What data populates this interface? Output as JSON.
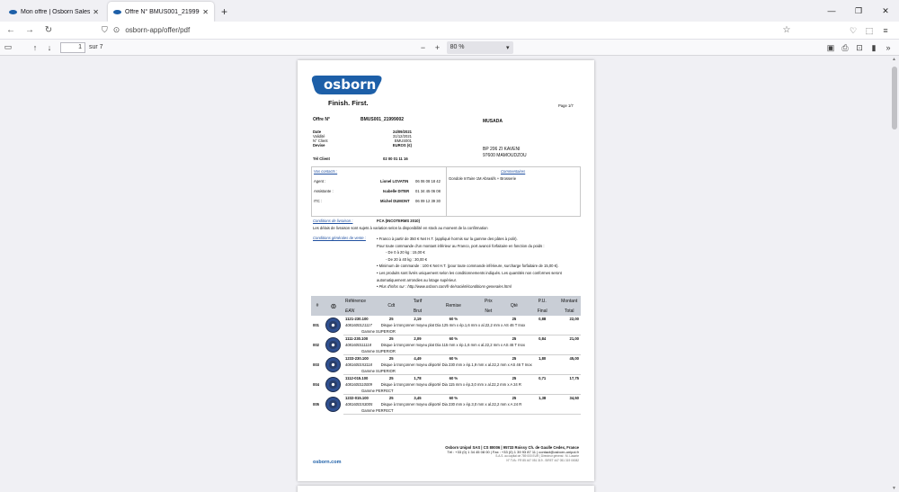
{
  "tabs": [
    {
      "title": "Mon offre | Osborn Sales Tool",
      "active": false
    },
    {
      "title": "Offre N° BMUS001_21999002 - Osborn...",
      "active": true
    }
  ],
  "nav": {
    "url": "osborn-app/offer/pdf"
  },
  "pdf_toolbar": {
    "page_current": "1",
    "page_total_label": "sur 7",
    "zoom": "80 %"
  },
  "doc": {
    "logo_text": "osborn",
    "tagline": "Finish. First.",
    "page_label": "Page 1/7",
    "offer_label": "Offre N°",
    "offer_number": "BMUS001_21999002",
    "customer_name": "MUSADA",
    "info_rows": [
      {
        "label": "Date",
        "value": "24/09/2021"
      },
      {
        "label": "Validité",
        "value": "31/12/2021"
      },
      {
        "label": "N° Client",
        "value": "BMUS001"
      },
      {
        "label": "Devise",
        "value": "EUROS (€)"
      }
    ],
    "tel_label": "Tél Client",
    "tel_value": "02 00 01 11 16",
    "address_line1": "BP 206 ZI KAVENI",
    "address_line2": "97600 MAMOUDZOU",
    "contacts_title": "Vos contacts :",
    "contacts": [
      {
        "role": "Agent :",
        "name": "Lionel LOVATIN",
        "phone": "06 06 08 18 42"
      },
      {
        "role": "Assistante :",
        "name": "Isabelle DITER",
        "phone": "01 34 45 06 08"
      },
      {
        "role": "ITC :",
        "name": "Michel DUMONT",
        "phone": "06 09 12 39 30"
      }
    ],
    "comments_title": "Commentaires",
    "comments_text": "Gondole InTaire 1M Abrasifs + Brosserie",
    "delivery_label": "Conditions de livraison :",
    "delivery_value": "FCA (INCOTERMS 2010)",
    "delivery_note": "Les délais de livraison sont sujets à variation selon la disponibilité en stock au moment de la confirmation",
    "sales_label": "Conditions générales de vente :",
    "sales_lines": [
      "• Franco à partir de 350 € Net H.T. (appliqué hormis sur la gamme des pâtes à polir).",
      "Pour toute commande d'un montant inférieur au Franco, port avancé forfaitaire en fonction du poids :",
      "- De 0 à 20 kg : 15,00 €",
      "- De 20 à 40 kg : 30,00 €",
      "• Minimum de commande : 100 € Net H.T. (pour toute commande inférieure, surcharge forfaitaire de 15,00 €).",
      "• Les produits sont livrés uniquement selon les conditionnements indiqués. Les quantités non conformes seront",
      "automatiquement arrondies au lotage supérieur.",
      "• Plus d'infos sur : http://www.osborn.com/fr-de/société/conditions-generales.html"
    ],
    "table_headers": {
      "num": "#",
      "ref": "Référence",
      "ean": "EAN",
      "cdt": "Cdt",
      "tarif": "Tarif",
      "brut": "Brut",
      "remise": "Remise",
      "prix": "Prix",
      "net": "Net",
      "qte": "Qté",
      "pu": "P.U.",
      "final": "Final",
      "montant": "Montant",
      "total": "Total"
    },
    "items": [
      {
        "num": "001",
        "ref": "1121-230.100",
        "ean": "4081600121117",
        "cdt": "25",
        "brut": "2,19",
        "remise": "60 %",
        "qte": "25",
        "final": "0,88",
        "total": "22,00",
        "desc": "Disque à tronçonner moyeu plat Dia 125 mm x ép.1,6 mm x al.22,2 mm x AS 46 T Inox",
        "gamme": "Gamme SUPERIOR"
      },
      {
        "num": "002",
        "ref": "1111-230.100",
        "ean": "4081600111118",
        "cdt": "25",
        "brut": "2,09",
        "remise": "60 %",
        "qte": "25",
        "final": "0,84",
        "total": "21,00",
        "desc": "Disque à tronçonner moyeu plat Dia 115 mm x ép.1,6 mm x al.22,2 mm x AS 46 T Inox",
        "gamme": "Gamme SUPERIOR"
      },
      {
        "num": "003",
        "ref": "1233-230.100",
        "ean": "4081600153118",
        "cdt": "25",
        "brut": "4,49",
        "remise": "60 %",
        "qte": "25",
        "final": "1,80",
        "total": "45,00",
        "desc": "Disque à tronçonner moyeu déporté Dia 230 mm x ép.1,9 mm x al.22,2 mm x AS 46 T Inox",
        "gamme": "Gamme SUPERIOR"
      },
      {
        "num": "004",
        "ref": "1112-015.100",
        "ean": "4081600110009",
        "cdt": "25",
        "brut": "1,78",
        "remise": "60 %",
        "qte": "25",
        "final": "0,71",
        "total": "17,75",
        "desc": "Disque à tronçonner moyeu déporté Dia 115 mm x ép.3,0 mm x al.22,2 mm x A 24 R",
        "gamme": "Gamme PERFECT"
      },
      {
        "num": "005",
        "ref": "1232-015.100",
        "ean": "4081600153005",
        "cdt": "25",
        "brut": "3,45",
        "remise": "60 %",
        "qte": "25",
        "final": "1,38",
        "total": "34,50",
        "desc": "Disque à tronçonner moyeu déporté Dia 230 mm x ép.3,0 mm x al.22,2 mm x A 24 R",
        "gamme": "Gamme PERFECT"
      }
    ],
    "footer_line1": "Osborn Unipol SAS | CS 80006 | 95733 Roissy Ch. de Gaulle Cedex, France",
    "footer_line2": "Tél : +33 (0) 1 34 45 08 00 | Fax : +33 (0) 1 39 93 87 11 | contact@osborn-unipol.fr",
    "footer_line3": "S.A.S. au capital de 789 000 EUR | Directeur général : M. Lasarte",
    "footer_line4": "N° TVA : FR 85 447 051 319 - SIRET 447 051 319 00082",
    "footer_site": "osborn.com"
  }
}
